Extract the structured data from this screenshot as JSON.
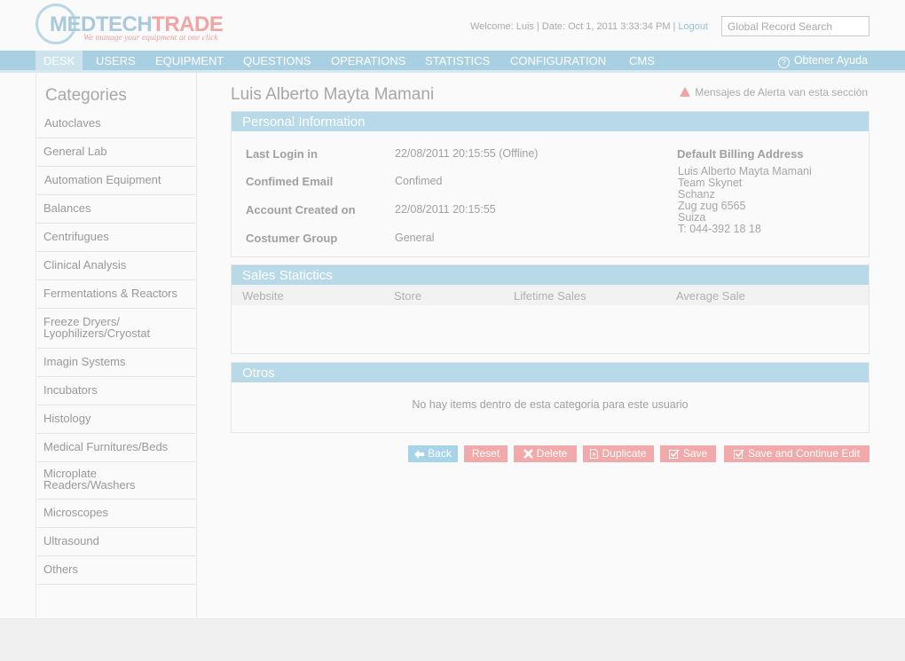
{
  "brand": {
    "name_part1": "MEDTECH",
    "name_part2": "TRADE",
    "tagline": "We manage your equipment at one click"
  },
  "header": {
    "welcome": "Welcome: Luis",
    "date": "Date: Oct 1, 2011 3:33:34 PM",
    "logout": "Logout",
    "search_placeholder": "Global Record Search"
  },
  "nav": {
    "items": [
      "DESK",
      "USERS",
      "EQUIPMENT",
      "QUESTIONS",
      "OPERATIONS",
      "STATISTICS",
      "CONFIGURATION",
      "CMS"
    ],
    "active": "DESK",
    "help": "Obtener Ayuda"
  },
  "sidebar": {
    "title": "Categories",
    "items": [
      "Autoclaves",
      "General Lab",
      "Automation Equipment",
      "Balances",
      "Centrifugues",
      "Clinical Analysis",
      "Fermentations & Reactors",
      "Freeze Dryers/ Lyophilizers/Cryostat",
      "Imagin Systems",
      "Incubators",
      "Histology",
      "Medical Furnitures/Beds",
      "Microplate Readers/Washers",
      "Microscopes",
      "Ultrasound",
      "Others"
    ]
  },
  "main": {
    "title": "Luis Alberto Mayta Mamani",
    "alert": "Mensajes de Alerta van esta sección",
    "personal": {
      "heading": "Personal Information",
      "fields": [
        {
          "label": "Last Login in",
          "value": "22/08/2011 20:15:55 (Offline)"
        },
        {
          "label": "Confimed Email",
          "value": "Confimed"
        },
        {
          "label": "Account Created on",
          "value": "22/08/2011 20:15:55"
        },
        {
          "label": "Costumer Group",
          "value": "General"
        }
      ],
      "billing_title": "Default Billing Address",
      "billing_lines": [
        "Luis Alberto Mayta Mamani",
        "Team Skynet",
        "Schanz",
        "Zug zug 6565",
        "Suiza",
        "T: 044-392 18 18"
      ]
    },
    "sales": {
      "heading": "Sales Statictics",
      "columns": [
        "Website",
        "Store",
        "Lifetime Sales",
        "Average Sale"
      ]
    },
    "otros": {
      "heading": "Otros",
      "empty": "No hay items dentro de esta categoria para este usuario"
    },
    "buttons": {
      "back": "Back",
      "reset": "Reset",
      "delete": "Delete",
      "duplicate": "Duplicate",
      "save": "Save",
      "save_continue": "Save and Continue Edit"
    }
  },
  "colors": {
    "accent_blue": "#a9d0e2",
    "accent_red": "#f2a9a9"
  }
}
